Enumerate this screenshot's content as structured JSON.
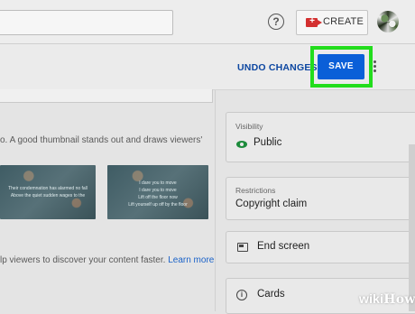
{
  "header": {
    "create_label": "CREATE",
    "help_symbol": "?",
    "icons": [
      "help-icon",
      "video-camera-add-icon",
      "avatar"
    ]
  },
  "actions": {
    "undo_label": "UNDO CHANGES",
    "save_label": "SAVE",
    "more_icon": "more-vertical-icon",
    "highlight_color": "#22dd1c",
    "save_color": "#0a5fd8"
  },
  "thumbnail": {
    "description": "o. A good thumbnail stands out and draws viewers'",
    "images": [
      {
        "lines": [
          "Their condemnation has alarmed no fall",
          "Above the quiet sudden wages to the",
          ""
        ]
      },
      {
        "lines": [
          "I dare you to move",
          "I dare you to move",
          "Lift off the floor now",
          "Lift yourself up off by the floor"
        ]
      }
    ]
  },
  "tags": {
    "description": "lp viewers to discover your content faster. ",
    "link": "Learn more"
  },
  "sidebar": {
    "visibility": {
      "label": "Visibility",
      "value": "Public",
      "icon": "eye-icon",
      "icon_color": "#1d8b3c"
    },
    "restrictions": {
      "label": "Restrictions",
      "value": "Copyright claim"
    },
    "end_screen": {
      "label": "End screen",
      "icon": "end-screen-icon"
    },
    "cards": {
      "label": "Cards",
      "icon": "info-icon"
    }
  },
  "watermark": {
    "wiki": "wiki",
    "how": "How"
  }
}
